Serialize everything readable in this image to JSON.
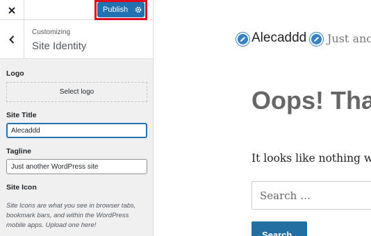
{
  "topbar": {
    "publish_label": "Publish"
  },
  "section": {
    "breadcrumb": "Customizing",
    "title": "Site Identity"
  },
  "fields": {
    "logo_label": "Logo",
    "select_logo_label": "Select logo",
    "site_title_label": "Site Title",
    "site_title_value": "Alecaddd",
    "tagline_label": "Tagline",
    "tagline_value": "Just another WordPress site",
    "site_icon_label": "Site Icon",
    "site_icon_description": "Site Icons are what you see in browser tabs, bookmark bars, and within the WordPress mobile apps. Upload one here!"
  },
  "preview": {
    "site_name": "Alecaddd",
    "site_tagline": "Just another WordPress site",
    "heading": "Oops! That page can't be found.",
    "message": "It looks like nothing was found at this location.",
    "search_placeholder": "Search …",
    "search_button": "Search"
  },
  "colors": {
    "accent": "#2271b1",
    "highlight": "#e0091e",
    "edit_icon": "#3582c4"
  },
  "icons": [
    "close-icon",
    "gear-icon",
    "chevron-left-icon",
    "pencil-icon"
  ]
}
